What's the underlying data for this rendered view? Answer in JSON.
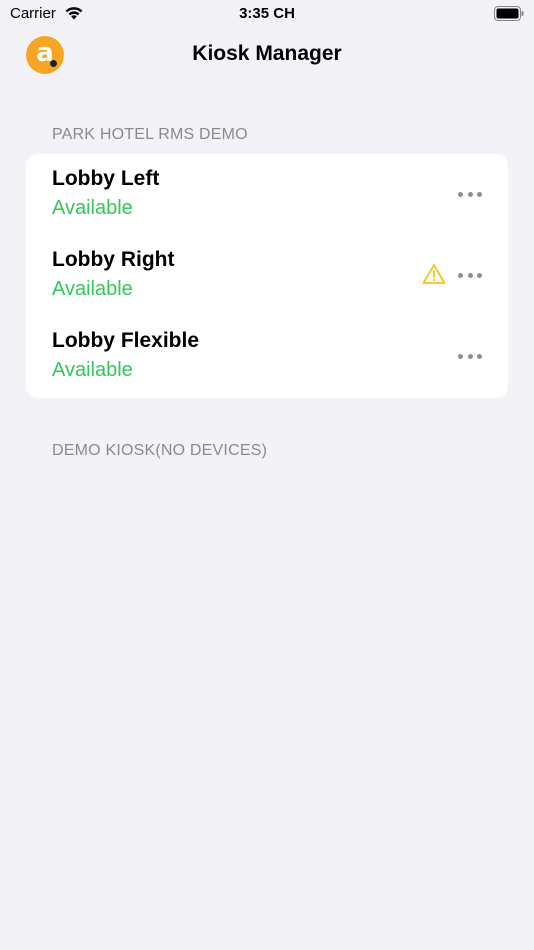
{
  "status_bar": {
    "carrier": "Carrier",
    "time": "3:35 CH",
    "wifi_icon": "wifi-icon",
    "battery_icon": "battery-icon"
  },
  "nav": {
    "title": "Kiosk Manager",
    "logo_letter": "a",
    "logo_color": "#f6a623"
  },
  "sections": [
    {
      "header": "PARK HOTEL RMS DEMO",
      "kiosks": [
        {
          "name": "Lobby Left",
          "status": "Available",
          "warning": false
        },
        {
          "name": "Lobby Right",
          "status": "Available",
          "warning": true
        },
        {
          "name": "Lobby Flexible",
          "status": "Available",
          "warning": false
        }
      ]
    },
    {
      "header": "DEMO KIOSK(NO DEVICES)",
      "kiosks": []
    }
  ],
  "colors": {
    "background": "#f2f2f7",
    "status_available": "#34c759",
    "warning": "#f5c518",
    "secondary_text": "#8a8a8e"
  }
}
